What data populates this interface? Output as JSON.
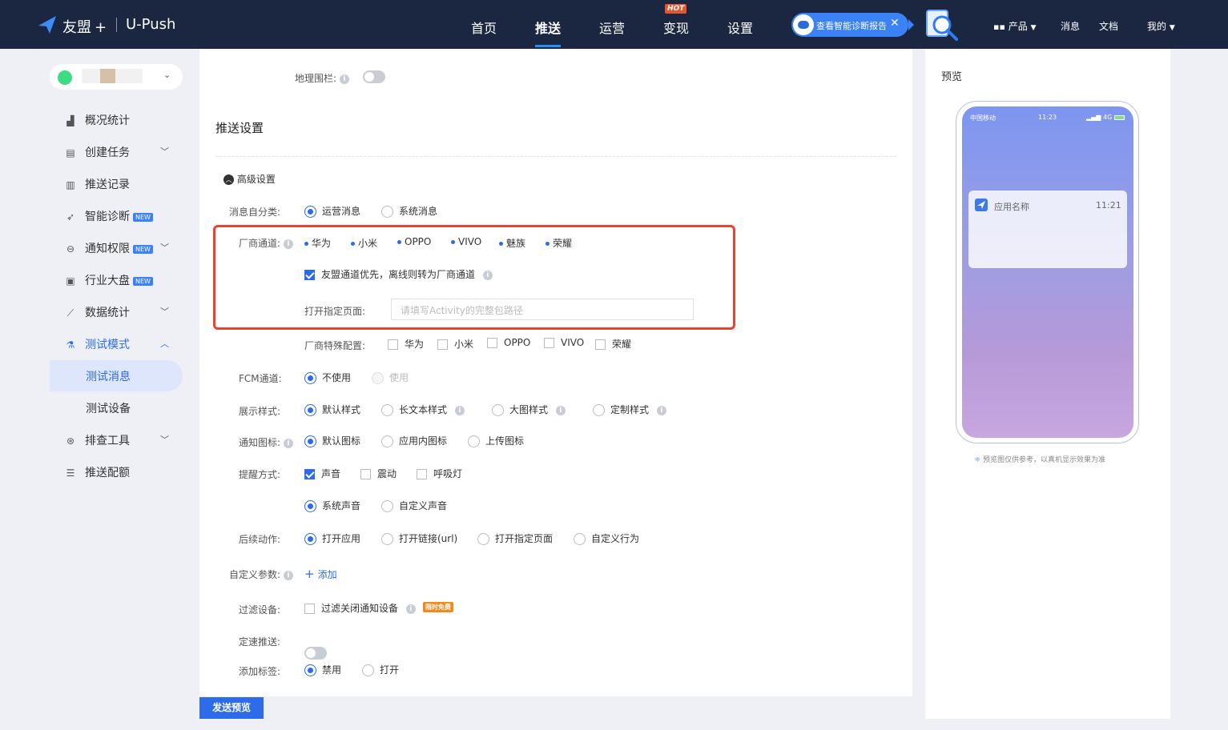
{
  "topbar": {
    "brand": "友盟",
    "brand_plus": "+",
    "product": "U-Push",
    "nav": [
      "首页",
      "推送",
      "运营",
      "变现",
      "设置"
    ],
    "active_nav": "推送",
    "hot_badge": "HOT",
    "diagnose_label": "查看智能诊断报告",
    "right": {
      "products": "产品",
      "messages": "消息",
      "docs": "文档",
      "mine": "我的"
    }
  },
  "sidebar": {
    "items": [
      {
        "label": "概况统计",
        "icon": "bar-chart-icon"
      },
      {
        "label": "创建任务",
        "icon": "task-icon",
        "chevron": "down"
      },
      {
        "label": "推送记录",
        "icon": "record-icon"
      },
      {
        "label": "智能诊断",
        "icon": "diagnose-icon",
        "badge": "NEW"
      },
      {
        "label": "通知权限",
        "icon": "toggle-icon",
        "badge": "NEW",
        "chevron": "down"
      },
      {
        "label": "行业大盘",
        "icon": "dashboard-icon",
        "badge": "NEW"
      },
      {
        "label": "数据统计",
        "icon": "line-chart-icon",
        "chevron": "down"
      },
      {
        "label": "测试模式",
        "icon": "flask-icon",
        "chevron": "up",
        "active": true
      },
      {
        "label": "测试消息",
        "sub": true,
        "selected": true
      },
      {
        "label": "测试设备",
        "sub": true
      },
      {
        "label": "排查工具",
        "icon": "tool-icon",
        "chevron": "down"
      },
      {
        "label": "推送配额",
        "icon": "sliders-icon"
      }
    ]
  },
  "form": {
    "geofence_label": "地理围栏:",
    "section_title": "推送设置",
    "advanced_label": "高级设置",
    "msg_category": {
      "label": "消息自分类:",
      "options": [
        "运营消息",
        "系统消息"
      ],
      "selected": 0
    },
    "vendor_channel": {
      "label": "厂商通道:",
      "vendors": [
        "华为",
        "小米",
        "OPPO",
        "VIVO",
        "魅族",
        "荣耀"
      ]
    },
    "umeng_priority": "友盟通道优先，离线则转为厂商通道",
    "open_page": {
      "label": "打开指定页面:",
      "placeholder": "请填写Activity的完整包路径"
    },
    "vendor_special": {
      "label": "厂商特殊配置:",
      "options": [
        "华为",
        "小米",
        "OPPO",
        "VIVO",
        "荣耀"
      ]
    },
    "fcm": {
      "label": "FCM通道:",
      "options": [
        "不使用",
        "使用"
      ],
      "selected": 0
    },
    "display_style": {
      "label": "展示样式:",
      "options": [
        "默认样式",
        "长文本样式",
        "大图样式",
        "定制样式"
      ],
      "selected": 0
    },
    "notif_icon": {
      "label": "通知图标:",
      "options": [
        "默认图标",
        "应用内图标",
        "上传图标"
      ],
      "selected": 0
    },
    "remind": {
      "label": "提醒方式:",
      "options": [
        "声音",
        "震动",
        "呼吸灯"
      ],
      "checked": [
        true,
        false,
        false
      ]
    },
    "sound": {
      "options": [
        "系统声音",
        "自定义声音"
      ],
      "selected": 0
    },
    "after_action": {
      "label": "后续动作:",
      "options": [
        "打开应用",
        "打开链接(url)",
        "打开指定页面",
        "自定义行为"
      ],
      "selected": 0
    },
    "custom_params": {
      "label": "自定义参数:",
      "add": "添加"
    },
    "filter": {
      "label": "过滤设备:",
      "option": "过滤关闭通知设备",
      "badge": "限时免费"
    },
    "rate_push": {
      "label": "定速推送:"
    },
    "add_tag": {
      "label": "添加标签:",
      "options": [
        "禁用",
        "打开"
      ],
      "selected": 0
    },
    "send_button": "发送预览"
  },
  "preview": {
    "title": "预览",
    "carrier": "中国移动",
    "time": "11:23",
    "network": "4G",
    "app_name": "应用名称",
    "notif_time": "11:21",
    "note": "预览图仅供参考，以真机显示效果为准"
  }
}
